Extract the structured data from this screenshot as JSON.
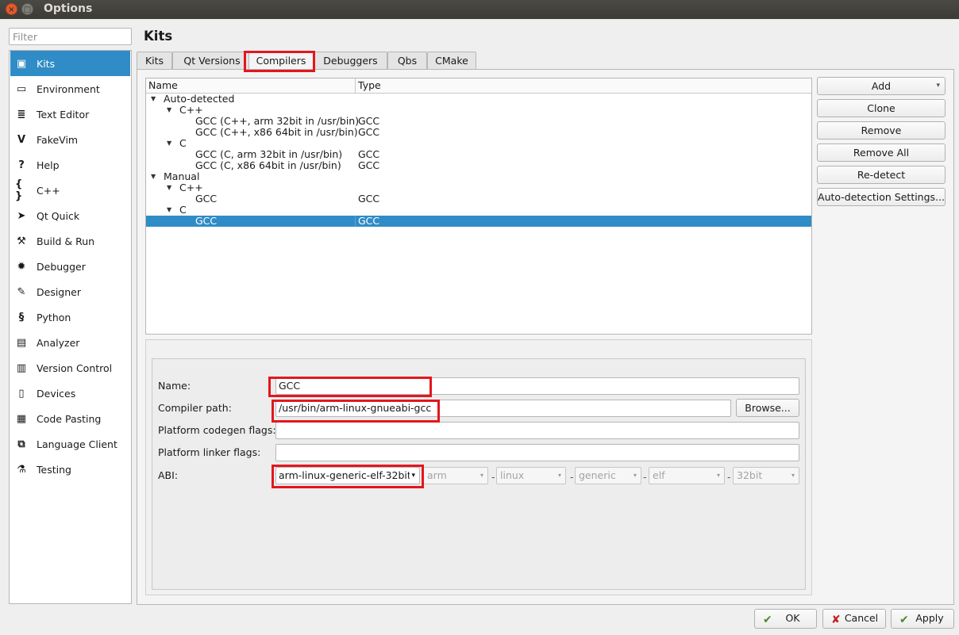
{
  "window": {
    "title": "Options",
    "close_glyph": "×",
    "max_glyph": "□"
  },
  "sidebar": {
    "filter_placeholder": "Filter",
    "items": [
      {
        "label": "Kits",
        "icon": "kits-icon",
        "glyph": "▣"
      },
      {
        "label": "Environment",
        "icon": "monitor-icon",
        "glyph": "▭"
      },
      {
        "label": "Text Editor",
        "icon": "text-editor-icon",
        "glyph": "≣"
      },
      {
        "label": "FakeVim",
        "icon": "fakevim-icon",
        "glyph": "V"
      },
      {
        "label": "Help",
        "icon": "help-icon",
        "glyph": "?"
      },
      {
        "label": "C++",
        "icon": "cpp-icon",
        "glyph": "{ }"
      },
      {
        "label": "Qt Quick",
        "icon": "qt-quick-icon",
        "glyph": "➤"
      },
      {
        "label": "Build & Run",
        "icon": "hammer-icon",
        "glyph": "⚒"
      },
      {
        "label": "Debugger",
        "icon": "bug-icon",
        "glyph": "✹"
      },
      {
        "label": "Designer",
        "icon": "pencil-icon",
        "glyph": "✎"
      },
      {
        "label": "Python",
        "icon": "python-icon",
        "glyph": "§"
      },
      {
        "label": "Analyzer",
        "icon": "analyzer-icon",
        "glyph": "▤"
      },
      {
        "label": "Version Control",
        "icon": "version-control-icon",
        "glyph": "▥"
      },
      {
        "label": "Devices",
        "icon": "devices-icon",
        "glyph": "▯"
      },
      {
        "label": "Code Pasting",
        "icon": "clipboard-icon",
        "glyph": "▦"
      },
      {
        "label": "Language Client",
        "icon": "language-client-icon",
        "glyph": "⧉"
      },
      {
        "label": "Testing",
        "icon": "testing-icon",
        "glyph": "⚗"
      }
    ]
  },
  "main": {
    "title": "Kits",
    "tabs": [
      "Kits",
      "Qt Versions",
      "Compilers",
      "Debuggers",
      "Qbs",
      "CMake"
    ],
    "active_tab": "Compilers"
  },
  "tree": {
    "columns": [
      "Name",
      "Type"
    ],
    "rows": [
      {
        "name": "Auto-detected",
        "type": "",
        "level": 0,
        "expanded": true
      },
      {
        "name": "C++",
        "type": "",
        "level": 1,
        "expanded": true
      },
      {
        "name": "GCC (C++, arm 32bit in /usr/bin)",
        "type": "GCC",
        "level": 2
      },
      {
        "name": "GCC (C++, x86 64bit in /usr/bin)",
        "type": "GCC",
        "level": 2
      },
      {
        "name": "C",
        "type": "",
        "level": 1,
        "expanded": true
      },
      {
        "name": "GCC (C, arm 32bit in /usr/bin)",
        "type": "GCC",
        "level": 2
      },
      {
        "name": "GCC (C, x86 64bit in /usr/bin)",
        "type": "GCC",
        "level": 2
      },
      {
        "name": "Manual",
        "type": "",
        "level": 0,
        "expanded": true
      },
      {
        "name": "C++",
        "type": "",
        "level": 1,
        "expanded": true
      },
      {
        "name": "GCC",
        "type": "GCC",
        "level": 2
      },
      {
        "name": "C",
        "type": "",
        "level": 1,
        "expanded": true
      },
      {
        "name": "GCC",
        "type": "GCC",
        "level": 2,
        "selected": true
      }
    ],
    "expand_glyph": "▼"
  },
  "buttons": {
    "add": "Add",
    "add_arrow": "▾",
    "clone": "Clone",
    "remove": "Remove",
    "remove_all": "Remove All",
    "redetect": "Re-detect",
    "autodetect_settings": "Auto-detection Settings..."
  },
  "details": {
    "name_label": "Name:",
    "name_value": "GCC",
    "compiler_path_label": "Compiler path:",
    "compiler_path_value": "/usr/bin/arm-linux-gnueabi-gcc",
    "browse": "Browse...",
    "codegen_label": "Platform codegen flags:",
    "codegen_value": "",
    "linker_label": "Platform linker flags:",
    "linker_value": "",
    "abi_label": "ABI:",
    "abi_value": "arm-linux-generic-elf-32bit",
    "abi_parts": [
      "arm",
      "linux",
      "generic",
      "elf",
      "32bit"
    ],
    "dash": "-",
    "dd_glyph": "▾",
    "highlight_color": "#e4161e"
  },
  "footer": {
    "ok": "OK",
    "cancel": "Cancel",
    "apply": "Apply",
    "ok_glyph": "✔",
    "cancel_glyph": "✘",
    "apply_glyph": "✔"
  },
  "colors": {
    "selection": "#308cc6",
    "highlight": "#e4161e"
  }
}
